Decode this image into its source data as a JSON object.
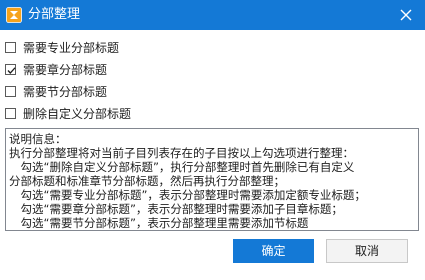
{
  "window": {
    "title": "分部整理",
    "icon": "app-logo-icon",
    "close_icon": "close-icon",
    "accent_color": "#1479d6"
  },
  "options": [
    {
      "label": "需要专业分部标题",
      "checked": false
    },
    {
      "label": "需要章分部标题",
      "checked": true
    },
    {
      "label": "需要节分部标题",
      "checked": false
    },
    {
      "label": "删除自定义分部标题",
      "checked": false
    }
  ],
  "info": {
    "lines": [
      "说明信息：",
      "执行分部整理将对当前子目列表存在的子目按以上勾选项进行整理：",
      "　勾选“删除自定义分部标题”，执行分部整理时首先删除已有自定义",
      "分部标题和标准章节分部标题，然后再执行分部整理；",
      "　勾选“需要专业分部标题”，表示分部整理时需要添加定额专业标题；",
      "　勾选“需要章分部标题”，表示分部整理时需要添加子目章标题；",
      "　勾选“需要节分部标题”，表示分部整理里需要添加节标题"
    ]
  },
  "buttons": {
    "ok": "确定",
    "cancel": "取消"
  }
}
